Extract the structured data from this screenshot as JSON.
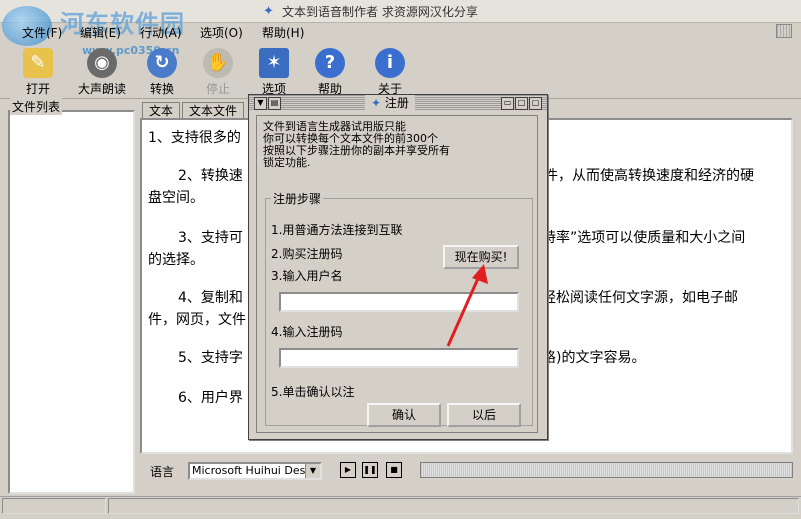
{
  "window": {
    "title": "文本到语音制作者 求资源网汉化分享"
  },
  "watermark": {
    "site_name": "河东软件园",
    "url": "www.pc0359.cn"
  },
  "menu": [
    "文件(F)",
    "编辑(E)",
    "行动(A)",
    "选项(O)",
    "帮助(H)"
  ],
  "toolbar": {
    "open": "打开",
    "read_aloud": "大声朗读",
    "convert": "转换",
    "stop": "停止",
    "options": "选项",
    "help": "帮助",
    "about": "关于"
  },
  "sidebar": {
    "label": "文件列表"
  },
  "tabs": [
    "文本",
    "文本文件"
  ],
  "editor": {
    "lines": [
      "1、支持很多的",
      "2、转换速",
      "件，从而使高转换速度和经济的硬",
      "盘空间。",
      "3、支持可",
      "特率”选项可以使质量和大小之间",
      "的选择。",
      "4、复制和",
      "轻松阅读任何文字源，如电子邮",
      "件，网页，文件",
      "5、支持字",
      "格)的文字容易。",
      "6、用户界"
    ]
  },
  "dialog": {
    "title": "注册",
    "intro": [
      "文件到语言生成器试用版只能",
      "你可以转换每个文本文件的前300个",
      "按照以下步骤注册你的副本并享受所有",
      "锁定功能."
    ],
    "group_label": "注册步骤",
    "step1": "1.用普通方法连接到互联",
    "step2": "2.购买注册码",
    "step3": "3.输入用户名",
    "step4": "4.输入注册码",
    "step5": "5.单击确认以注",
    "buy_now": "现在购买!",
    "confirm": "确认",
    "later": "以后",
    "username_value": "",
    "regcode_value": ""
  },
  "bottom": {
    "language_label": "语言",
    "voice_selected": "Microsoft Huihui Desktop"
  },
  "colors": {
    "annotation_arrow": "#e02020",
    "title_icon": "#3a6cc0"
  }
}
